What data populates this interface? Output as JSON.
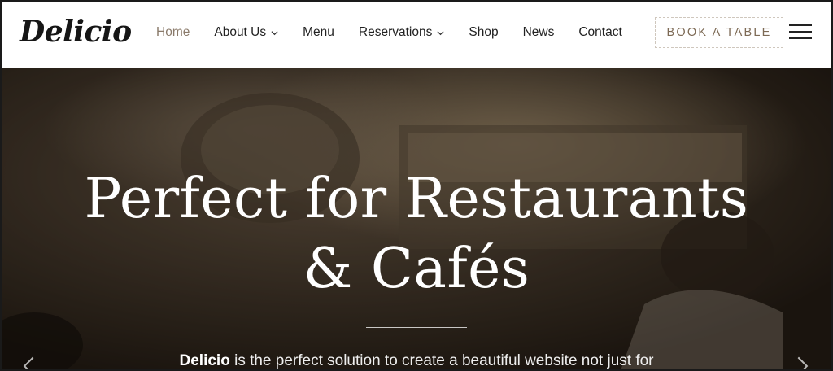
{
  "header": {
    "logo": "Delicio",
    "nav": [
      {
        "label": "Home",
        "active": true,
        "dropdown": false
      },
      {
        "label": "About Us",
        "active": false,
        "dropdown": true
      },
      {
        "label": "Menu",
        "active": false,
        "dropdown": false
      },
      {
        "label": "Reservations",
        "active": false,
        "dropdown": true
      },
      {
        "label": "Shop",
        "active": false,
        "dropdown": false
      },
      {
        "label": "News",
        "active": false,
        "dropdown": false
      },
      {
        "label": "Contact",
        "active": false,
        "dropdown": false
      }
    ],
    "cta": "BOOK A TABLE",
    "menu_icon": "hamburger-icon"
  },
  "hero": {
    "title_line1": "Perfect for Restaurants",
    "title_line2": "& Cafés",
    "subtitle_bold": "Delicio",
    "subtitle_rest": " is the perfect solution to create a beautiful website not just for"
  },
  "colors": {
    "accent": "#8a7a6a",
    "cta_text": "#7d6a55",
    "header_bg": "#ffffff"
  }
}
